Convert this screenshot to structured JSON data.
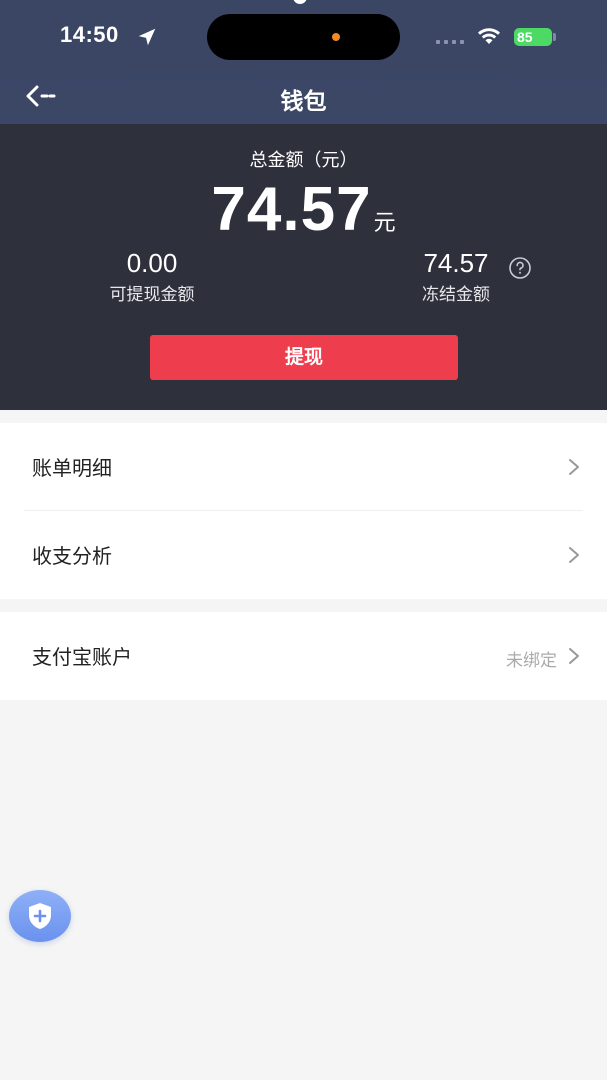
{
  "status_bar": {
    "time": "14:50",
    "battery": "85"
  },
  "nav": {
    "title": "钱包"
  },
  "summary": {
    "total_label": "总金额（元）",
    "total_amount": "74.57",
    "total_unit": "元",
    "withdrawable_amount": "0.00",
    "withdrawable_label": "可提现金额",
    "frozen_amount": "74.57",
    "frozen_label": "冻结金额",
    "withdraw_button": "提现"
  },
  "menu": {
    "bill_details": "账单明细",
    "income_expense_analysis": "收支分析",
    "alipay_account": "支付宝账户",
    "alipay_status": "未绑定"
  },
  "colors": {
    "header_bg": "#3c4767",
    "summary_bg": "#2e313b",
    "accent_red": "#ee3e4d",
    "battery_green": "#4cd964"
  },
  "icons": [
    "location-arrow-icon",
    "wifi-icon",
    "back-arrow-icon",
    "help-icon",
    "chevron-right-icon",
    "shield-plus-icon"
  ]
}
